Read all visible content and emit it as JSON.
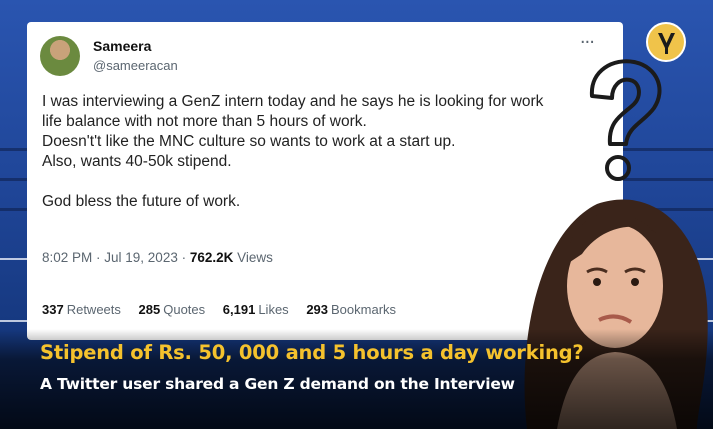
{
  "tweet": {
    "author_name": "Sameera",
    "author_handle": "@sameeracan",
    "text_lines": [
      "I was interviewing a GenZ intern today and he says he is looking for work",
      "life balance with not more than 5 hours of work.",
      "Doesn't't like the MNC culture so wants to work at a start up.",
      "Also, wants 40-50k stipend.",
      "",
      "God bless the future of work."
    ],
    "timestamp": "8:02 PM · Jul 19, 2023 ·",
    "views_count": "762.2K",
    "views_label": "Views",
    "stats": [
      {
        "count": "337",
        "label": "Retweets"
      },
      {
        "count": "285",
        "label": "Quotes"
      },
      {
        "count": "6,191",
        "label": "Likes"
      },
      {
        "count": "293",
        "label": "Bookmarks"
      }
    ]
  },
  "headline": "Stipend of Rs. 50, 000 and 5 hours a day working?",
  "subheadline": "A Twitter user shared a Gen Z demand on the Interview",
  "icons": {
    "more": "more-options-icon",
    "question": "question-mark-icon",
    "logo": "brand-logo"
  },
  "colors": {
    "headline": "#f5c22d",
    "background": "#1f4597"
  }
}
